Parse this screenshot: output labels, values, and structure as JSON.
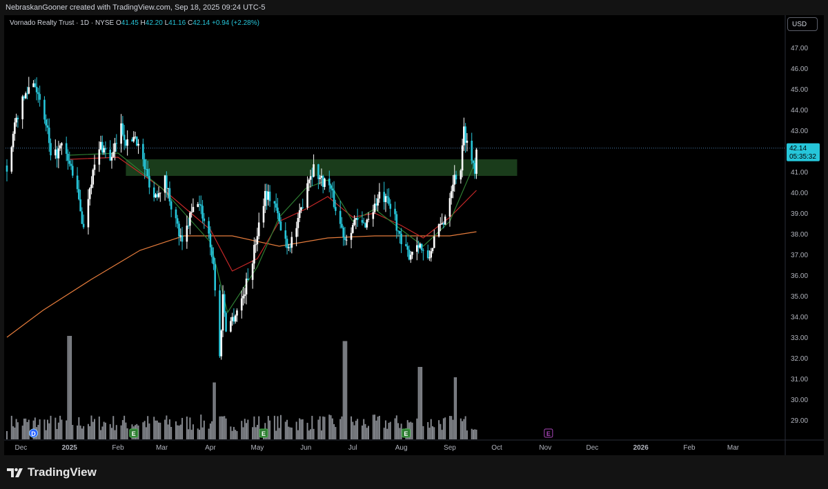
{
  "header": {
    "credit": "NebraskanGooner created with TradingView.com, Sep 18, 2025 09:24 UTC-5"
  },
  "legend": {
    "symbol": "Vornado Realty Trust · 1D · NYSE",
    "o_label": "O",
    "o": "41.45",
    "h_label": "H",
    "h": "42.20",
    "l_label": "L",
    "l": "41.16",
    "c_label": "C",
    "c": "42.14",
    "change": "+0.94 (+2.28%)"
  },
  "currency": "USD",
  "price_tag": {
    "price": "42.14",
    "countdown": "05:35:32"
  },
  "brand": {
    "name": "TradingView",
    "logo_icon": "tradingview-logo-icon"
  },
  "colors": {
    "up": "#26c6da",
    "down": "#26c6da",
    "zone": "#1e4620",
    "sma_fast": "#2e7d32",
    "sma_mid": "#c62828",
    "sma_slow": "#e67c3c",
    "price_line": "#4a7fb0",
    "event_dividend": "#2962ff",
    "event_earnings": "#2e7d32",
    "event_future": "#ab47bc"
  },
  "chart_data": {
    "type": "candlestick",
    "symbol": "Vornado Realty Trust",
    "interval": "1D",
    "exchange": "NYSE",
    "y_ticks": [
      29,
      30,
      31,
      32,
      33,
      34,
      35,
      36,
      37,
      38,
      39,
      40,
      41,
      42,
      43,
      44,
      45,
      46,
      47
    ],
    "y_tick_labels": [
      "29.00",
      "30.00",
      "31.00",
      "32.00",
      "33.00",
      "34.00",
      "35.00",
      "36.00",
      "37.00",
      "38.00",
      "39.00",
      "40.00",
      "41.00",
      "42.00",
      "43.00",
      "44.00",
      "45.00",
      "46.00",
      "47.00"
    ],
    "x_tick_labels": [
      "Dec",
      "2025",
      "Feb",
      "Mar",
      "Apr",
      "May",
      "Jun",
      "Jul",
      "Aug",
      "Sep",
      "Oct",
      "Nov",
      "Dec",
      "2026",
      "Feb",
      "Mar"
    ],
    "x_tick_dates": [
      "2024-12-01",
      "2025-01-01",
      "2025-02-01",
      "2025-03-01",
      "2025-04-01",
      "2025-05-01",
      "2025-06-01",
      "2025-07-01",
      "2025-08-01",
      "2025-09-01",
      "2025-10-01",
      "2025-11-01",
      "2025-12-01",
      "2026-01-01",
      "2026-02-01",
      "2026-03-01"
    ],
    "current_price": 42.14,
    "resistance_zone": {
      "low": 40.8,
      "high": 41.6,
      "from": "2025-02-06",
      "to": "2025-10-14"
    },
    "price_keypoints": [
      [
        "2024-11-22",
        41.3
      ],
      [
        "2024-11-29",
        43.8
      ],
      [
        "2024-12-06",
        45.1
      ],
      [
        "2024-12-10",
        45.4
      ],
      [
        "2024-12-13",
        44.2
      ],
      [
        "2024-12-18",
        43.0
      ],
      [
        "2024-12-20",
        41.5
      ],
      [
        "2024-12-27",
        42.2
      ],
      [
        "2025-01-03",
        41.0
      ],
      [
        "2025-01-08",
        39.2
      ],
      [
        "2025-01-10",
        38.2
      ],
      [
        "2025-01-14",
        40.4
      ],
      [
        "2025-01-21",
        42.3
      ],
      [
        "2025-01-28",
        41.6
      ],
      [
        "2025-02-03",
        43.2
      ],
      [
        "2025-02-07",
        42.3
      ],
      [
        "2025-02-12",
        42.8
      ],
      [
        "2025-02-18",
        41.2
      ],
      [
        "2025-02-24",
        39.8
      ],
      [
        "2025-03-03",
        40.6
      ],
      [
        "2025-03-10",
        38.6
      ],
      [
        "2025-03-14",
        37.4
      ],
      [
        "2025-03-19",
        38.8
      ],
      [
        "2025-03-24",
        39.6
      ],
      [
        "2025-03-31",
        38.0
      ],
      [
        "2025-04-03",
        36.5
      ],
      [
        "2025-04-07",
        32.0
      ],
      [
        "2025-04-09",
        35.0
      ],
      [
        "2025-04-11",
        33.5
      ],
      [
        "2025-04-16",
        34.0
      ],
      [
        "2025-04-22",
        35.0
      ],
      [
        "2025-04-28",
        36.8
      ],
      [
        "2025-05-02",
        38.5
      ],
      [
        "2025-05-06",
        40.0
      ],
      [
        "2025-05-12",
        39.5
      ],
      [
        "2025-05-16",
        38.2
      ],
      [
        "2025-05-21",
        37.4
      ],
      [
        "2025-05-27",
        38.5
      ],
      [
        "2025-06-02",
        40.6
      ],
      [
        "2025-06-06",
        41.2
      ],
      [
        "2025-06-11",
        40.6
      ],
      [
        "2025-06-16",
        40.4
      ],
      [
        "2025-06-20",
        39.2
      ],
      [
        "2025-06-26",
        37.8
      ],
      [
        "2025-07-02",
        38.6
      ],
      [
        "2025-07-08",
        38.4
      ],
      [
        "2025-07-14",
        39.2
      ],
      [
        "2025-07-18",
        39.8
      ],
      [
        "2025-07-23",
        39.5
      ],
      [
        "2025-07-28",
        38.8
      ],
      [
        "2025-08-01",
        37.4
      ],
      [
        "2025-08-06",
        37.0
      ],
      [
        "2025-08-12",
        37.6
      ],
      [
        "2025-08-18",
        36.6
      ],
      [
        "2025-08-22",
        37.8
      ],
      [
        "2025-08-28",
        38.6
      ],
      [
        "2025-09-03",
        40.6
      ],
      [
        "2025-09-08",
        41.2
      ],
      [
        "2025-09-10",
        43.0
      ],
      [
        "2025-09-12",
        42.4
      ],
      [
        "2025-09-15",
        41.6
      ],
      [
        "2025-09-17",
        41.2
      ],
      [
        "2025-09-18",
        42.14
      ]
    ],
    "ma_slow_keypoints": [
      [
        "2024-11-22",
        33.0
      ],
      [
        "2024-12-15",
        34.3
      ],
      [
        "2025-01-15",
        35.8
      ],
      [
        "2025-02-15",
        37.2
      ],
      [
        "2025-03-15",
        37.9
      ],
      [
        "2025-04-15",
        37.9
      ],
      [
        "2025-05-15",
        37.4
      ],
      [
        "2025-06-15",
        37.8
      ],
      [
        "2025-07-15",
        37.9
      ],
      [
        "2025-08-15",
        37.9
      ],
      [
        "2025-09-01",
        37.9
      ],
      [
        "2025-09-18",
        38.1
      ]
    ],
    "ma_mid_keypoints": [
      [
        "2025-01-01",
        41.6
      ],
      [
        "2025-02-01",
        41.7
      ],
      [
        "2025-03-01",
        40.2
      ],
      [
        "2025-04-01",
        38.2
      ],
      [
        "2025-04-15",
        36.2
      ],
      [
        "2025-05-01",
        36.8
      ],
      [
        "2025-05-15",
        38.6
      ],
      [
        "2025-06-01",
        39.2
      ],
      [
        "2025-06-15",
        39.8
      ],
      [
        "2025-07-01",
        38.8
      ],
      [
        "2025-07-15",
        39.0
      ],
      [
        "2025-08-01",
        38.4
      ],
      [
        "2025-08-15",
        37.8
      ],
      [
        "2025-09-01",
        38.8
      ],
      [
        "2025-09-18",
        40.1
      ]
    ],
    "ma_fast_keypoints": [
      [
        "2025-01-01",
        41.8
      ],
      [
        "2025-02-01",
        41.9
      ],
      [
        "2025-03-01",
        40.2
      ],
      [
        "2025-04-01",
        37.6
      ],
      [
        "2025-04-12",
        34.2
      ],
      [
        "2025-05-01",
        36.4
      ],
      [
        "2025-05-15",
        38.8
      ],
      [
        "2025-06-01",
        40.2
      ],
      [
        "2025-06-15",
        40.6
      ],
      [
        "2025-07-01",
        38.6
      ],
      [
        "2025-07-15",
        39.2
      ],
      [
        "2025-08-01",
        38.2
      ],
      [
        "2025-08-15",
        37.4
      ],
      [
        "2025-09-01",
        38.6
      ],
      [
        "2025-09-18",
        41.6
      ]
    ],
    "volume_spikes": [
      [
        "2025-01-01",
        1.0
      ],
      [
        "2025-04-04",
        0.55
      ],
      [
        "2025-06-26",
        0.95
      ],
      [
        "2025-08-13",
        0.7
      ],
      [
        "2025-09-05",
        0.6
      ]
    ],
    "events": [
      {
        "date": "2024-12-09",
        "label": "D",
        "kind": "dividend"
      },
      {
        "date": "2025-02-11",
        "label": "E",
        "kind": "earnings"
      },
      {
        "date": "2025-05-05",
        "label": "E",
        "kind": "earnings"
      },
      {
        "date": "2025-08-04",
        "label": "E",
        "kind": "earnings"
      },
      {
        "date": "2025-11-03",
        "label": "E",
        "kind": "future"
      }
    ]
  }
}
